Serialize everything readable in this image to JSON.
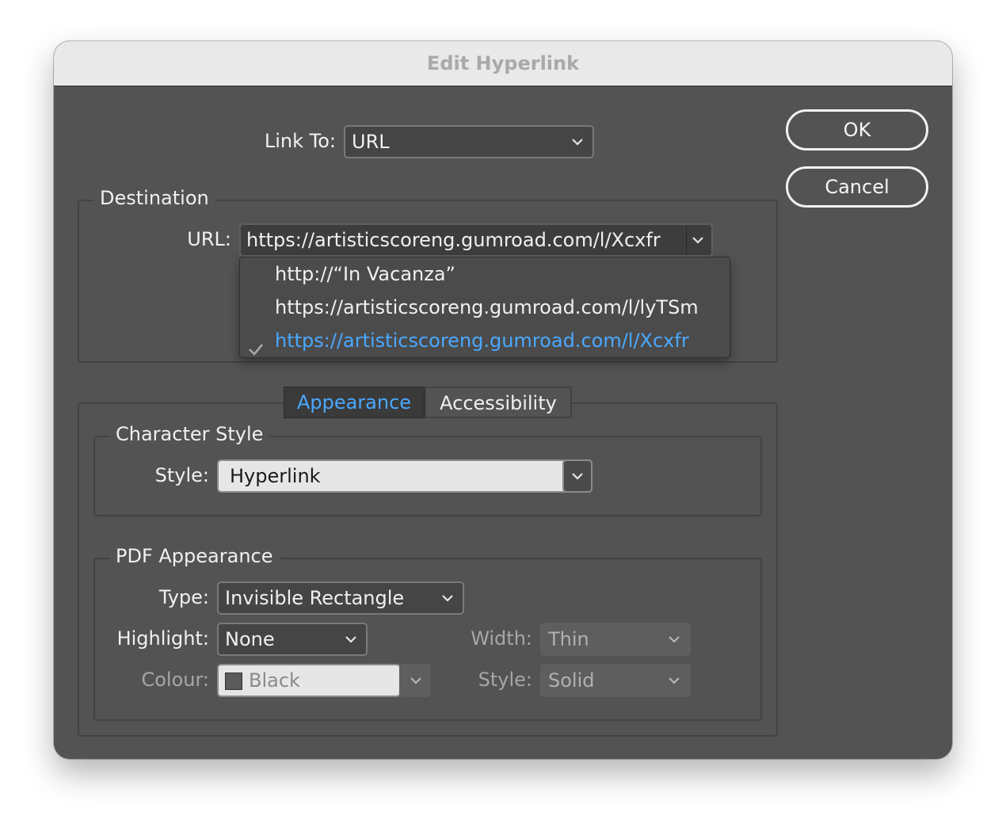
{
  "dialog": {
    "title": "Edit Hyperlink"
  },
  "buttons": {
    "ok": "OK",
    "cancel": "Cancel"
  },
  "link_to": {
    "label": "Link To:",
    "value": "URL"
  },
  "destination": {
    "legend": "Destination",
    "url_label": "URL:",
    "url_value": "https://artisticscoreng.gumroad.com/l/Xcxfr",
    "dropdown_items": [
      {
        "label": "http://“In Vacanza”",
        "selected": false
      },
      {
        "label": "https://artisticscoreng.gumroad.com/l/lyTSm",
        "selected": false
      },
      {
        "label": "https://artisticscoreng.gumroad.com/l/Xcxfr",
        "selected": true
      }
    ]
  },
  "tabs": [
    {
      "label": "Appearance",
      "active": true
    },
    {
      "label": "Accessibility",
      "active": false
    }
  ],
  "character_style": {
    "legend": "Character Style",
    "style_label": "Style:",
    "style_value": "Hyperlink"
  },
  "pdf_appearance": {
    "legend": "PDF Appearance",
    "type_label": "Type:",
    "type_value": "Invisible Rectangle",
    "highlight_label": "Highlight:",
    "highlight_value": "None",
    "width_label": "Width:",
    "width_value": "Thin",
    "colour_label": "Colour:",
    "colour_value": "Black",
    "style_label": "Style:",
    "style_value": "Solid"
  },
  "colors": {
    "accent": "#4aa8ff",
    "window_bg": "#535353",
    "titlebar_bg": "#e9e9e9"
  }
}
